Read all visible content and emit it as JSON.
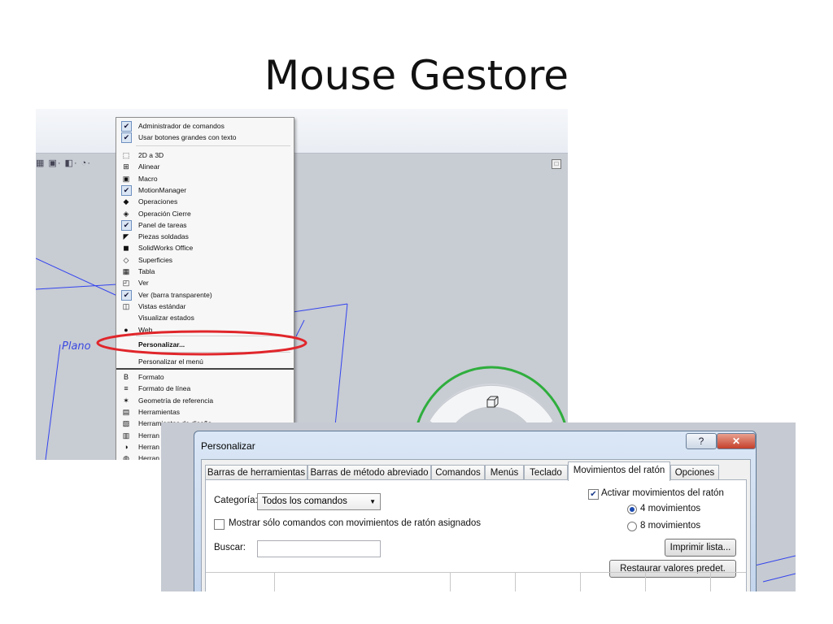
{
  "slide": {
    "title": "Mouse Gestore"
  },
  "viewport": {
    "plane_label": "Plano"
  },
  "context_menu": {
    "items_top": [
      {
        "label": "Administrador de comandos",
        "icon": "check-icon"
      },
      {
        "label": "Usar botones grandes con texto",
        "icon": "check-icon"
      }
    ],
    "items": [
      {
        "label": "2D a 3D",
        "icon": "2d-3d-icon",
        "glyph": "⬚"
      },
      {
        "label": "Alinear",
        "icon": "align-icon",
        "glyph": "⊞"
      },
      {
        "label": "Macro",
        "icon": "macro-icon",
        "glyph": "▣"
      },
      {
        "label": "MotionManager",
        "icon": "check-icon",
        "glyph": "✔"
      },
      {
        "label": "Operaciones",
        "icon": "features-icon",
        "glyph": "◆"
      },
      {
        "label": "Operación Cierre",
        "icon": "closure-icon",
        "glyph": "◈"
      },
      {
        "label": "Panel de tareas",
        "icon": "check-icon",
        "glyph": "✔"
      },
      {
        "label": "Piezas soldadas",
        "icon": "weldment-icon",
        "glyph": "◤"
      },
      {
        "label": "SolidWorks Office",
        "icon": "office-icon",
        "glyph": "◼"
      },
      {
        "label": "Superficies",
        "icon": "surfaces-icon",
        "glyph": "◇"
      },
      {
        "label": "Tabla",
        "icon": "table-icon",
        "glyph": "▦"
      },
      {
        "label": "Ver",
        "icon": "view-icon",
        "glyph": "◰"
      },
      {
        "label": "Ver (barra transparente)",
        "icon": "check-icon",
        "glyph": "✔"
      },
      {
        "label": "Vistas estándar",
        "icon": "standard-views-icon",
        "glyph": "◫"
      },
      {
        "label": "Visualizar estados",
        "icon": "",
        "glyph": ""
      },
      {
        "label": "Web",
        "icon": "web-globe-icon",
        "glyph": "●"
      }
    ],
    "customize": "Personalizar...",
    "customize_menu": "Personalizar el menú",
    "items_bottom": [
      {
        "label": "Formato",
        "icon": "format-icon",
        "glyph": "B"
      },
      {
        "label": "Formato de línea",
        "icon": "line-format-icon",
        "glyph": "≡"
      },
      {
        "label": "Geometría de referencia",
        "icon": "reference-geometry-icon",
        "glyph": "✶"
      },
      {
        "label": "Herramientas",
        "icon": "tools-icon",
        "glyph": "▤"
      },
      {
        "label": "Herramientas de diseño",
        "icon": "design-tools-icon",
        "glyph": "▧"
      },
      {
        "label": "Herran",
        "icon": "tools-icon-2",
        "glyph": "▥"
      },
      {
        "label": "Herran",
        "icon": "color-wheel-icon",
        "glyph": "◑"
      },
      {
        "label": "Herran",
        "icon": "tools-icon-3",
        "glyph": "◍"
      }
    ]
  },
  "dialog": {
    "title": "Personalizar",
    "help": "?",
    "close": "✕",
    "tabs": [
      "Barras de herramientas",
      "Barras de método abreviado",
      "Comandos",
      "Menús",
      "Teclado",
      "Movimientos del ratón",
      "Opciones"
    ],
    "active_tab": "Movimientos del ratón",
    "category_label": "Categoría:",
    "category_value": "Todos los comandos",
    "show_only_label": "Mostrar sólo comandos con movimientos de ratón asignados",
    "search_label": "Buscar:",
    "search_value": "",
    "enable_label": "Activar movimientos del ratón",
    "enable_checked": true,
    "radio_4": "4 movimientos",
    "radio_8": "8 movimientos",
    "selected_movements": 4,
    "print_list": "Imprimir lista...",
    "restore_defaults": "Restaurar valores predet."
  },
  "colors": {
    "highlight_ellipse": "#e0262b",
    "gesture_ring": "#2fae3d",
    "sketch_lines": "#3344ee"
  }
}
